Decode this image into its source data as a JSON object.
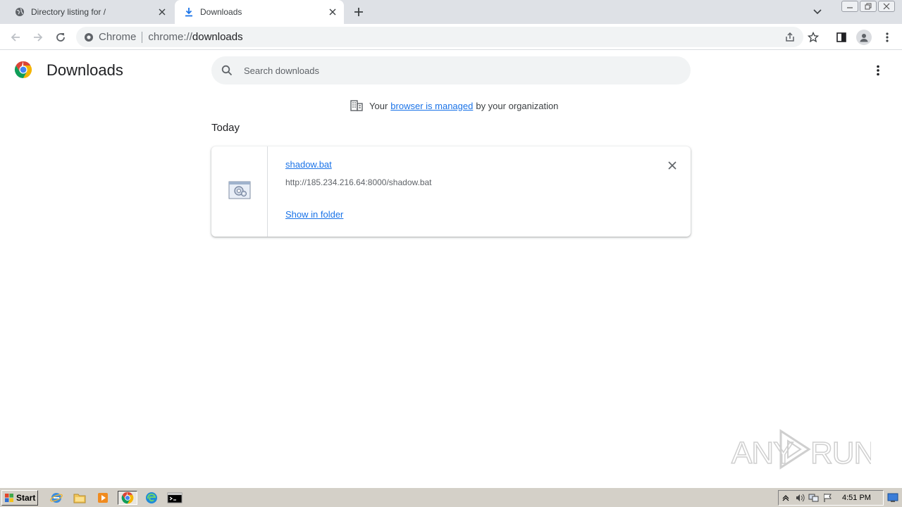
{
  "tabs": [
    {
      "title": "Directory listing for /",
      "icon": "globe-icon"
    },
    {
      "title": "Downloads",
      "icon": "download-icon",
      "active": true
    }
  ],
  "omnibox": {
    "chip": "Chrome",
    "url_prefix": "chrome://",
    "url_main": "downloads"
  },
  "page": {
    "title": "Downloads",
    "search_placeholder": "Search downloads",
    "managed": {
      "before": "Your",
      "link": "browser is managed",
      "after": "by your organization"
    },
    "section": "Today"
  },
  "downloads": [
    {
      "filename": "shadow.bat",
      "url": "http://185.234.216.64:8000/shadow.bat",
      "action": "Show in folder"
    }
  ],
  "watermark": "ANY RUN",
  "taskbar": {
    "start": "Start",
    "clock": "4:51 PM"
  },
  "colors": {
    "accent": "#1a73e8",
    "tabstrip": "#dee1e6",
    "taskbar": "#d4d0c8"
  }
}
